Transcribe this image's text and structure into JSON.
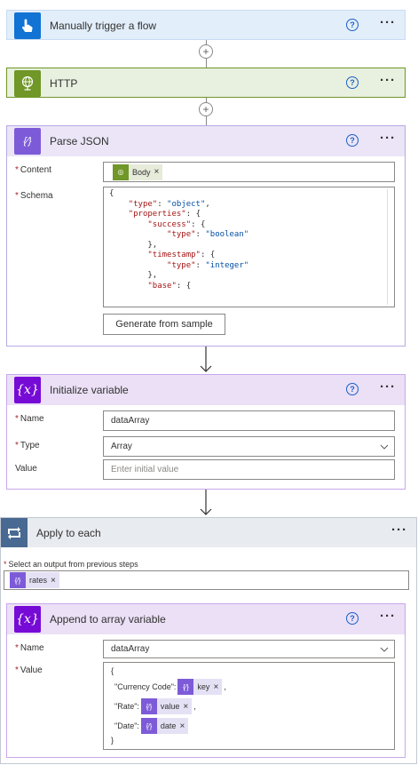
{
  "trigger": {
    "title": "Manually trigger a flow"
  },
  "http": {
    "title": "HTTP"
  },
  "parse_json": {
    "title": "Parse JSON",
    "content_label": "Content",
    "content_token": "Body",
    "schema_label": "Schema",
    "schema_lines": [
      "{",
      "    \"type\": \"object\",",
      "    \"properties\": {",
      "        \"success\": {",
      "            \"type\": \"boolean\"",
      "        },",
      "        \"timestamp\": {",
      "            \"type\": \"integer\"",
      "        },",
      "        \"base\": {"
    ],
    "generate_button": "Generate from sample"
  },
  "init_var": {
    "title": "Initialize variable",
    "name_label": "Name",
    "name_value": "dataArray",
    "type_label": "Type",
    "type_value": "Array",
    "value_label": "Value",
    "value_placeholder": "Enter initial value"
  },
  "apply_each": {
    "title": "Apply to each",
    "select_label": "Select an output from previous steps",
    "select_token": "rates"
  },
  "append": {
    "title": "Append to array variable",
    "name_label": "Name",
    "name_value": "dataArray",
    "value_label": "Value",
    "open_brace": "{",
    "close_brace": "}",
    "row1_key": "\"Currency Code\":",
    "row1_token": "key",
    "row2_key": "\"Rate\":",
    "row2_token": "value",
    "row3_key": "\"Date\":",
    "row3_token": "date",
    "comma": ","
  },
  "colors": {
    "trigger_header": "#e2eefa",
    "trigger_icon": "#1173d4",
    "http_header": "#e8f0e0",
    "http_icon": "#709727",
    "parse_header": "#ebe5f7",
    "parse_icon": "#7d5bd8",
    "variable_header": "#ebe0f6",
    "variable_icon": "#770bd6",
    "apply_header": "#e8ebf0",
    "apply_icon": "#486991",
    "token_bg": "#e5e1f5"
  },
  "icons": {
    "trigger": "hand-pointer-icon",
    "http": "globe-icon",
    "parse": "json-braces-icon",
    "variable": "variable-x-icon",
    "apply": "loop-icon"
  }
}
